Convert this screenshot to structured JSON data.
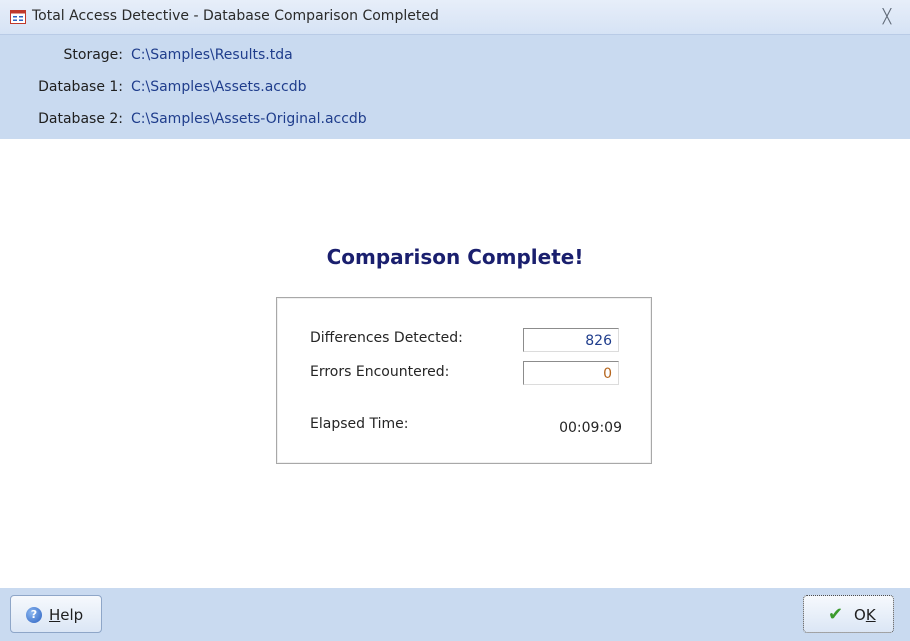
{
  "window": {
    "title": "Total Access Detective - Database Comparison Completed",
    "close_icon": "close-icon"
  },
  "info": {
    "storage_label": "Storage:",
    "storage_value": "C:\\Samples\\Results.tda",
    "db1_label": "Database 1:",
    "db1_value": "C:\\Samples\\Assets.accdb",
    "db2_label": "Database 2:",
    "db2_value": "C:\\Samples\\Assets-Original.accdb"
  },
  "result": {
    "headline": "Comparison Complete!",
    "differences_label": "Differences Detected:",
    "differences_value": "826",
    "errors_label": "Errors Encountered:",
    "errors_value": "0",
    "elapsed_label": "Elapsed Time:",
    "elapsed_value": "00:09:09"
  },
  "footer": {
    "help_accel": "H",
    "help_rest": "elp",
    "ok_first": "O",
    "ok_accel": "K"
  },
  "colors": {
    "accent_panel": "#c9daf0",
    "headline": "#1a1f6e",
    "path_text": "#1f3d8c",
    "differences_value": "#1f3d8c",
    "errors_value": "#b5651d",
    "ok_check": "#3b9a2c"
  }
}
